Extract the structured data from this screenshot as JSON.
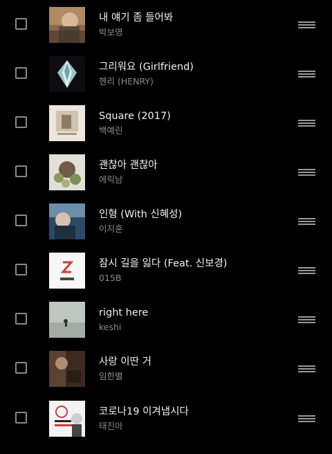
{
  "playlist": {
    "tracks": [
      {
        "title": "내 얘기 좀 들어봐",
        "artist": "박보영",
        "art_icon": "album-art-1"
      },
      {
        "title": "그리워요 (Girlfriend)",
        "artist": "헨리 (HENRY)",
        "art_icon": "album-art-2"
      },
      {
        "title": "Square (2017)",
        "artist": "백예린",
        "art_icon": "album-art-3"
      },
      {
        "title": "괜찮아 괜찮아",
        "artist": "에릭남",
        "art_icon": "album-art-4"
      },
      {
        "title": "인형 (With 신혜성)",
        "artist": "이지훈",
        "art_icon": "album-art-5"
      },
      {
        "title": "잠시 길을 잃다 (Feat. 신보경)",
        "artist": "015B",
        "art_icon": "album-art-6"
      },
      {
        "title": "right here",
        "artist": "keshi",
        "art_icon": "album-art-7"
      },
      {
        "title": "사랑 이딴 거",
        "artist": "임한별",
        "art_icon": "album-art-8"
      },
      {
        "title": "코로나19 이겨냅시다",
        "artist": "태진아",
        "art_icon": "album-art-9"
      }
    ]
  },
  "colors": {
    "background": "#000000",
    "title_text": "#f2f2f2",
    "artist_text": "#8c8c8c",
    "checkbox_border": "#8a8a8a",
    "drag_handle": "#9a9a9a"
  }
}
